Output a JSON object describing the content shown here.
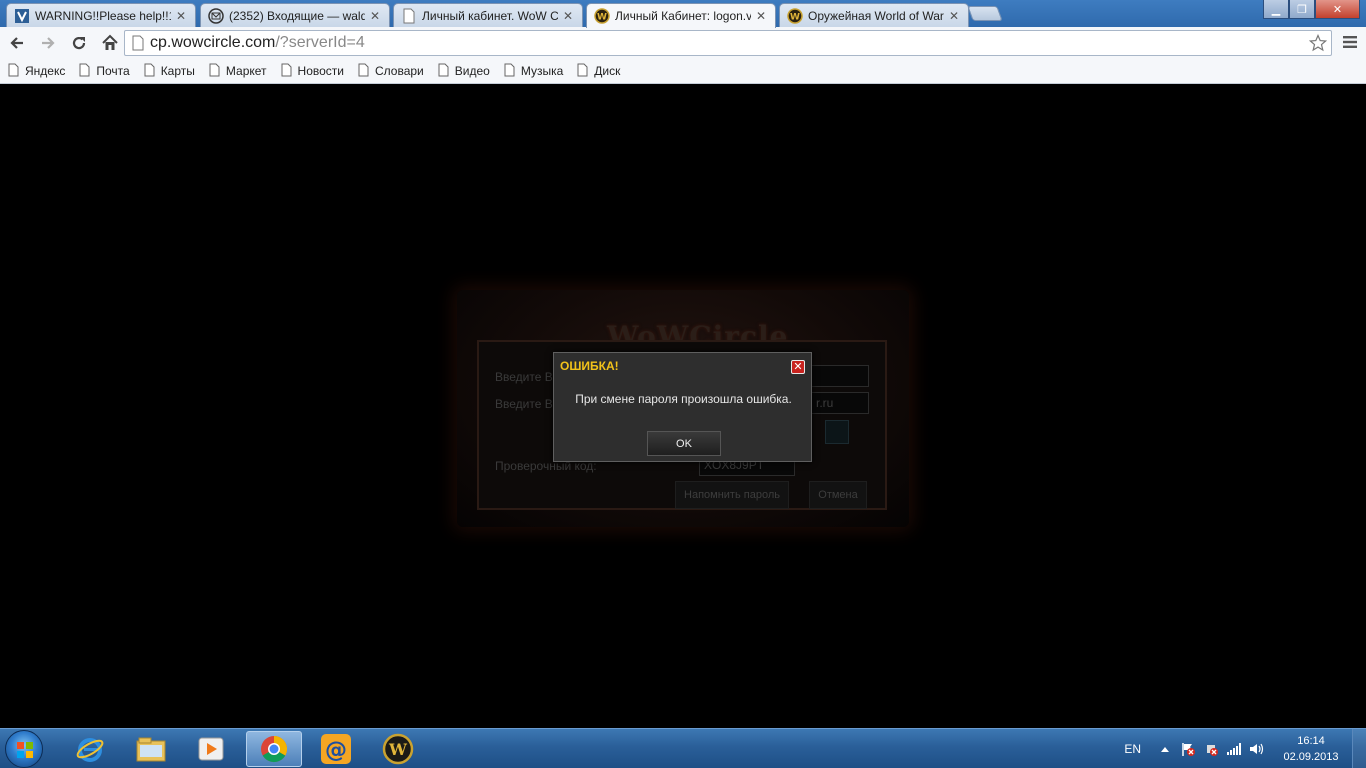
{
  "browser": {
    "tabs": [
      {
        "title": "WARNING!!Please help!!1!",
        "icon": "rutracker-icon",
        "active": false
      },
      {
        "title": "(2352) Входящие — waldo",
        "icon": "mail-icon",
        "active": false
      },
      {
        "title": "Личный кабинет. WoW C",
        "icon": "page-icon",
        "active": false
      },
      {
        "title": "Личный Кабинет: logon.v",
        "icon": "wow-icon",
        "active": true
      },
      {
        "title": "Оружейная World of War",
        "icon": "wow-icon",
        "active": false
      }
    ],
    "url_host": "cp.wowcircle.com",
    "url_path": "/?serverId=4",
    "bookmarks": [
      "Яндекс",
      "Почта",
      "Карты",
      "Маркет",
      "Новости",
      "Словари",
      "Видео",
      "Музыка",
      "Диск"
    ]
  },
  "login_form": {
    "logo": "WoWCircle",
    "field1_label": "Введите В",
    "field2_label": "Введите В",
    "field2_value": "r.ru",
    "captcha_label": "Проверочный код:",
    "captcha_value": "XOX8J9PT",
    "remind_button": "Напомнить пароль",
    "cancel_button": "Отмена"
  },
  "modal": {
    "title": "ОШИБКА!",
    "message": "При смене пароля произошла ошибка.",
    "ok_label": "OK",
    "close_symbol": "✕"
  },
  "taskbar": {
    "apps": [
      "internet-explorer-icon",
      "file-explorer-icon",
      "media-player-icon",
      "chrome-icon",
      "mail-agent-icon",
      "world-of-warcraft-icon"
    ],
    "language": "EN",
    "time": "16:14",
    "date": "02.09.2013"
  },
  "colors": {
    "modal_title": "#f2c21a",
    "modal_close": "#c9231f",
    "taskbar": "#2a5f99"
  }
}
